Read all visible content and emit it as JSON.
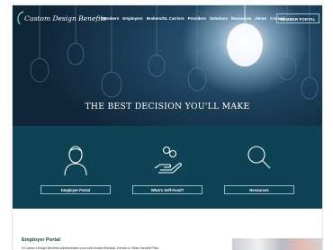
{
  "brand": {
    "name": "Custom Design Benefits"
  },
  "nav": {
    "items": [
      "Members",
      "Employers",
      "Brokers/GL Carriers",
      "Providers",
      "Solutions",
      "Resources",
      "About",
      "Contact"
    ],
    "member_portal": "MEMBER PORTAL"
  },
  "hero": {
    "tagline": "THE BEST DECISION YOU'LL MAKE"
  },
  "cards": [
    {
      "label": "Employer Portal",
      "icon": "person-icon"
    },
    {
      "label": "What's Self-Fund?",
      "icon": "hand-coins-icon"
    },
    {
      "label": "Resources",
      "icon": "magnifier-icon"
    }
  ],
  "section": {
    "title": "Employer Portal",
    "text": "If Custom Design Benefits administrates your self-funded Medical, Dental or Vision Benefit Plan,"
  },
  "colors": {
    "teal": "#0d4354",
    "accent": "#7fd6c8",
    "hero_dark": "#0f2638"
  }
}
